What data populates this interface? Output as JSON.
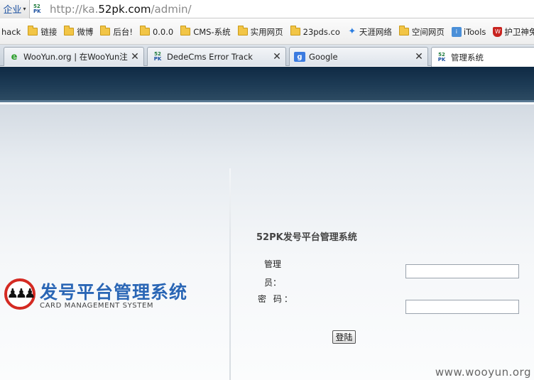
{
  "address_bar": {
    "left_label": "企业",
    "site_icon_top": "52",
    "site_icon_bottom": "PK",
    "url_prefix": "http://ka.",
    "url_domain": "52pk.com",
    "url_path": "/admin/"
  },
  "bookmarks": [
    {
      "label": "hack",
      "icon": "none"
    },
    {
      "label": "链接",
      "icon": "folder-icon"
    },
    {
      "label": "微博",
      "icon": "folder-icon"
    },
    {
      "label": "后台!",
      "icon": "folder-icon"
    },
    {
      "label": "0.0.0",
      "icon": "folder-icon"
    },
    {
      "label": "CMS-系统",
      "icon": "folder-icon"
    },
    {
      "label": "实用网页",
      "icon": "folder-icon"
    },
    {
      "label": "23pds.co",
      "icon": "folder-icon"
    },
    {
      "label": "天涯网络",
      "icon": "star-icon"
    },
    {
      "label": "空间网页",
      "icon": "folder-icon"
    },
    {
      "label": "iTools",
      "icon": "itools-icon"
    },
    {
      "label": "护卫神免",
      "icon": "shield-icon"
    }
  ],
  "tabs": [
    {
      "label": "WooYun.org | 在WooYun注...",
      "icon": "ie-icon",
      "active": false
    },
    {
      "label": "DedeCms Error Track",
      "icon": "52pk-icon",
      "active": false
    },
    {
      "label": "Google",
      "icon": "google-icon",
      "active": false
    },
    {
      "label": "管理系统",
      "icon": "52pk-icon",
      "active": true
    }
  ],
  "tab_close_glyph": "✕",
  "logo": {
    "title": "发号平台管理系统",
    "subtitle": "CARD MANAGEMENT SYSTEM"
  },
  "login_form": {
    "title": "52PK发号平台管理系统",
    "username_label": "管理员：",
    "password_label": "密 码：",
    "username_value": "",
    "password_value": "",
    "submit_label": "登陆"
  },
  "watermark": "www.wooyun.org",
  "colors": {
    "logo_blue": "#2a66b5",
    "logo_red": "#d42a22",
    "header_navy": "#1d3b55"
  }
}
